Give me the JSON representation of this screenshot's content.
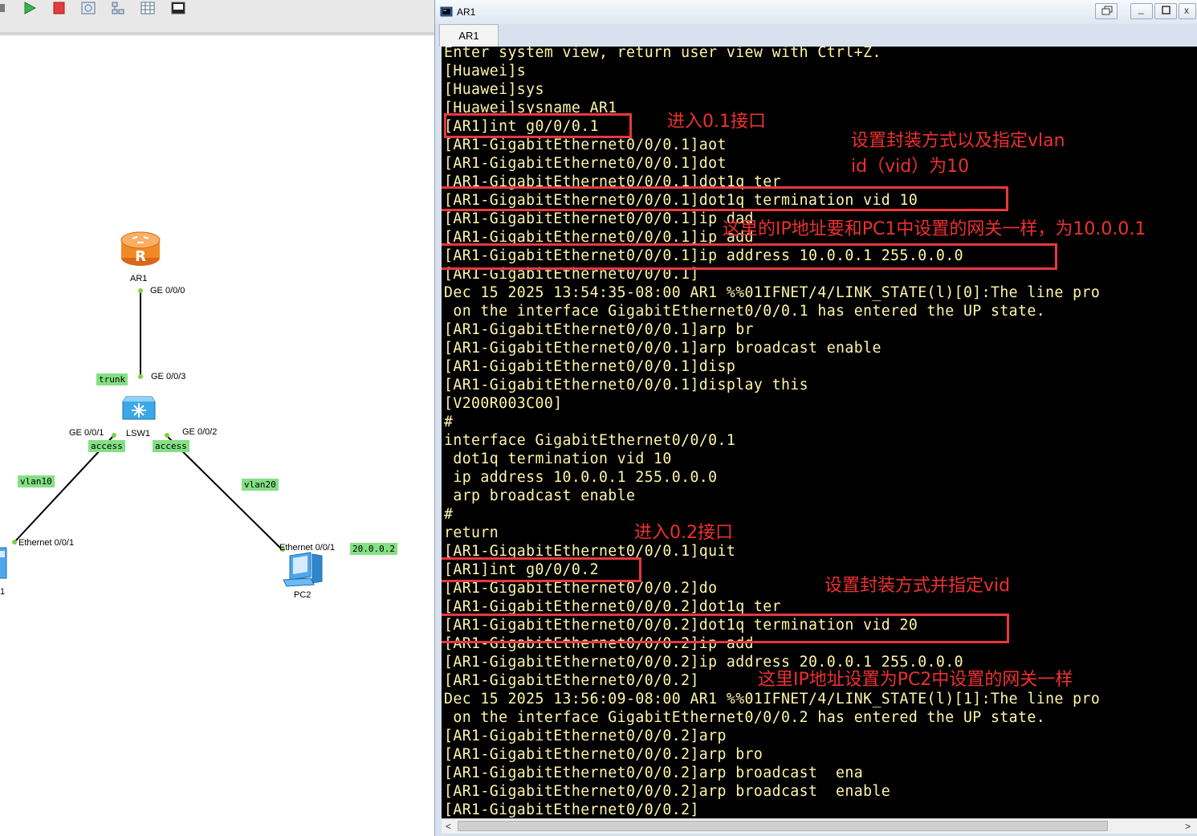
{
  "topology": {
    "devices": {
      "ar1": "AR1",
      "lsw1": "LSW1",
      "pc2": "PC2",
      "pc1_partial": "1"
    },
    "ports": {
      "ar1_ge000": "GE 0/0/0",
      "lsw1_ge003": "GE 0/0/3",
      "lsw1_ge001": "GE 0/0/1",
      "lsw1_ge002": "GE 0/0/2",
      "pc1_eth": "Ethernet 0/0/1",
      "pc2_eth": "Ethernet 0/0/1"
    },
    "tags": {
      "trunk": "trunk",
      "access_left": "access",
      "access_right": "access",
      "vlan10": "vlan10",
      "vlan20": "vlan20",
      "pc2_ip": "20.0.0.2"
    },
    "colors": {
      "tag_bg": "#84e084",
      "router": "#f08a24",
      "switch": "#3aa7e8",
      "pc": "#4fa6f0"
    }
  },
  "window": {
    "title": "AR1",
    "tab": "AR1",
    "buttons": {
      "restore": "restore-icon",
      "minimize": "minimize-icon",
      "maximize": "maximize-icon",
      "close": "close-icon"
    }
  },
  "terminal": {
    "lines": [
      "Enter system view, return user view with Ctrl+Z.",
      "[Huawei]s",
      "[Huawei]sys",
      "[Huawei]sysname AR1",
      "[AR1]int g0/0/0.1",
      "[AR1-GigabitEthernet0/0/0.1]aot",
      "[AR1-GigabitEthernet0/0/0.1]dot",
      "[AR1-GigabitEthernet0/0/0.1]dot1q ter",
      "[AR1-GigabitEthernet0/0/0.1]dot1q termination vid 10",
      "[AR1-GigabitEthernet0/0/0.1]ip dad",
      "[AR1-GigabitEthernet0/0/0.1]ip add",
      "[AR1-GigabitEthernet0/0/0.1]ip address 10.0.0.1 255.0.0.0",
      "[AR1-GigabitEthernet0/0/0.1]",
      "Dec 15 2025 13:54:35-08:00 AR1 %%01IFNET/4/LINK_STATE(l)[0]:The line pro",
      " on the interface GigabitEthernet0/0/0.1 has entered the UP state.",
      "[AR1-GigabitEthernet0/0/0.1]arp br",
      "[AR1-GigabitEthernet0/0/0.1]arp broadcast enable",
      "[AR1-GigabitEthernet0/0/0.1]disp",
      "[AR1-GigabitEthernet0/0/0.1]display this",
      "[V200R003C00]",
      "#",
      "interface GigabitEthernet0/0/0.1",
      " dot1q termination vid 10",
      " ip address 10.0.0.1 255.0.0.0",
      " arp broadcast enable",
      "#",
      "return",
      "[AR1-GigabitEthernet0/0/0.1]quit",
      "[AR1]int g0/0/0.2",
      "[AR1-GigabitEthernet0/0/0.2]do",
      "[AR1-GigabitEthernet0/0/0.2]dot1q ter",
      "[AR1-GigabitEthernet0/0/0.2]dot1q termination vid 20",
      "[AR1-GigabitEthernet0/0/0.2]ip add",
      "[AR1-GigabitEthernet0/0/0.2]ip address 20.0.0.1 255.0.0.0",
      "[AR1-GigabitEthernet0/0/0.2]",
      "Dec 15 2025 13:56:09-08:00 AR1 %%01IFNET/4/LINK_STATE(l)[1]:The line pro",
      " on the interface GigabitEthernet0/0/0.2 has entered the UP state.",
      "[AR1-GigabitEthernet0/0/0.2]arp",
      "[AR1-GigabitEthernet0/0/0.2]arp bro",
      "[AR1-GigabitEthernet0/0/0.2]arp broadcast  ena",
      "[AR1-GigabitEthernet0/0/0.2]arp broadcast  enable",
      "[AR1-GigabitEthernet0/0/0.2]"
    ],
    "colors": {
      "bg": "#000000",
      "fg": "#fff5a8"
    }
  },
  "annotations": {
    "a1": "进入0.1接口",
    "a2_line1": "设置封装方式以及指定vlan",
    "a2_line2": "id（vid）为10",
    "a3": "这里的IP地址要和PC1中设置的网关一样，为10.0.0.1",
    "a4": "进入0.2接口",
    "a5": "设置封装方式并指定vid",
    "a6": "这里IP地址设置为PC2中设置的网关一样",
    "color": "#ee3030"
  },
  "toolbar": {
    "icons": [
      "start-icon",
      "stop-icon",
      "capture-icon",
      "topology-icon",
      "grid-icon",
      "console-icon"
    ]
  }
}
